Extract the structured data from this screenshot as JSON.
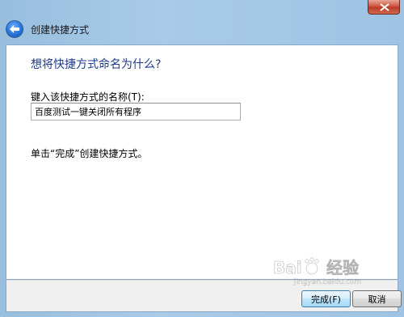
{
  "window": {
    "title": "创建快捷方式",
    "close_icon": "close-icon",
    "back_icon": "back-arrow-icon"
  },
  "content": {
    "heading": "想将快捷方式命名为什么?",
    "field_label": "键入该快捷方式的名称(T):",
    "name_value": "百度测试一键关闭所有程序",
    "hint": "单击“完成”创建快捷方式。"
  },
  "buttons": {
    "finish": "完成(F)",
    "cancel": "取消"
  },
  "watermark": {
    "brand": "Baidu 经验",
    "url": "jingyan.baidu.com"
  },
  "colors": {
    "heading": "#1e3a8c",
    "frame": "#a9cbe8",
    "close": "#c9503a"
  }
}
